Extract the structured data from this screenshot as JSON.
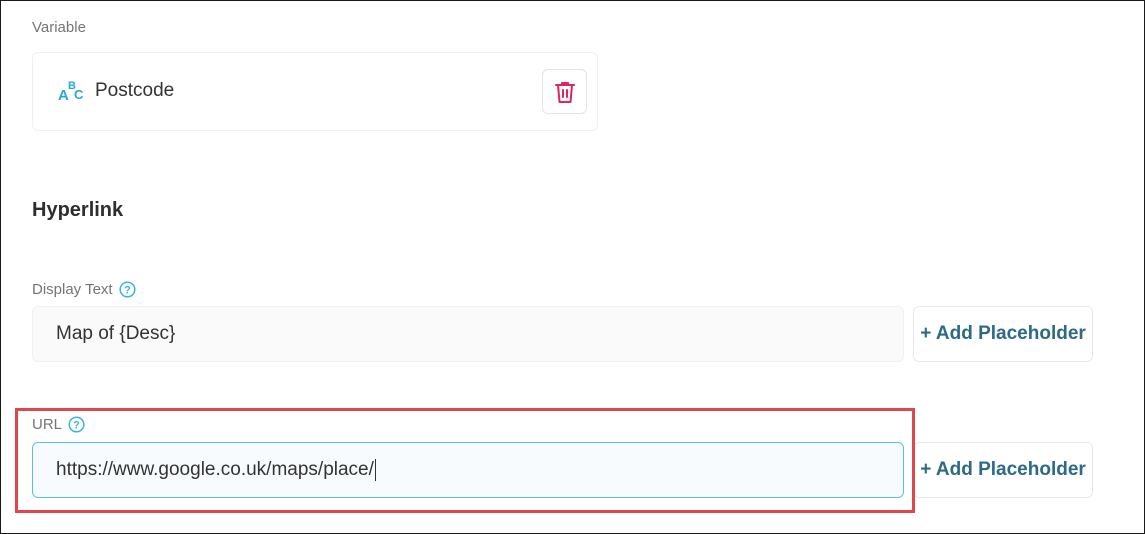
{
  "variable": {
    "section_label": "Variable",
    "name": "Postcode",
    "icon": "abc-text-icon",
    "delete_icon": "trash-icon"
  },
  "hyperlink": {
    "heading": "Hyperlink",
    "display_text": {
      "label": "Display Text",
      "value": "Map of {Desc}",
      "add_button": "+ Add Placeholder"
    },
    "url": {
      "label": "URL",
      "value": "https://www.google.co.uk/maps/place/",
      "add_button": "+ Add Placeholder"
    }
  },
  "colors": {
    "accent": "#2c6a86",
    "focus_border": "#59c3dc",
    "help_icon": "#3ab7d8",
    "delete_icon": "#e0245e",
    "highlight": "#e0474c"
  }
}
